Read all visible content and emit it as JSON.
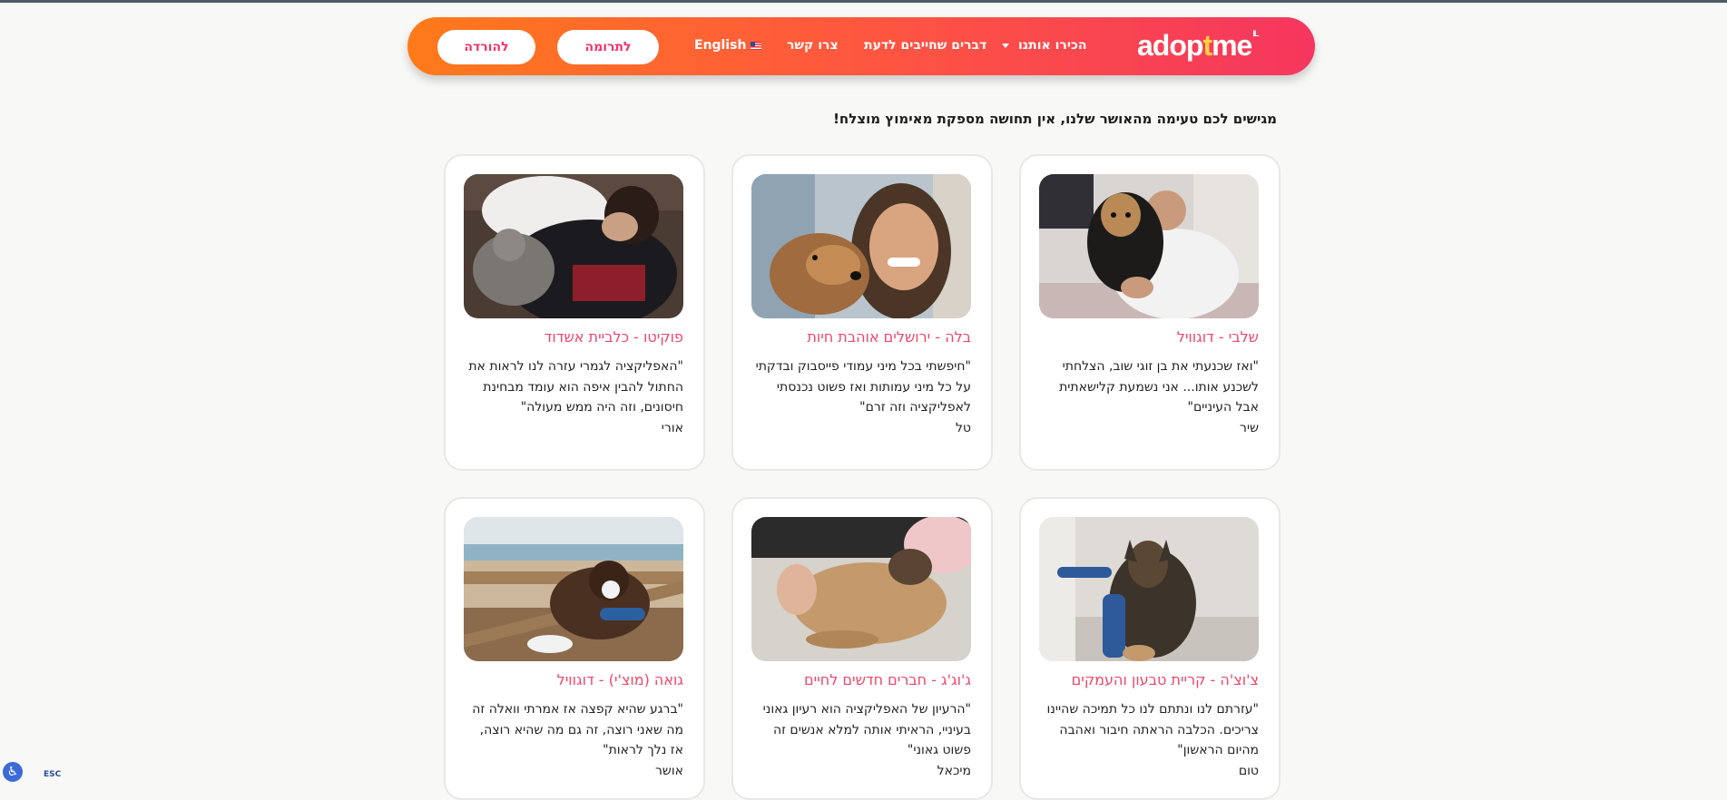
{
  "nav": {
    "download": "להורדה",
    "donate": "לתרומה",
    "english": "English",
    "contact": "צרו קשר",
    "must_know": "דברים שחייבים לדעת",
    "about": "הכירו אותנו",
    "logo_main": "adop",
    "logo_star": "t",
    "logo_end": "me",
    "logo_mark": "IL"
  },
  "headline": "מגישים לכם טעימה מהאושר שלנו, אין תחושה מספקת מאימוץ מוצלח!",
  "cards": [
    {
      "title": "שלבי - דוגוויל",
      "quote": "\"ואז שכנעתי את בן זוגי שוב, הצלחתי לשכנע אותו... אני נשמעת קלישאתית אבל העיניים\"",
      "author": "שיר"
    },
    {
      "title": "בלה - ירושלים אוהבת חיות",
      "quote": "\"חיפשתי בכל מיני עמודי פייסבוק ובדקתי על כל מיני עמותות ואז פשוט נכנסתי לאפליקציה וזה זרם\"",
      "author": "טל"
    },
    {
      "title": "פוקיטו - כלביית אשדוד",
      "quote": "\"האפליקציה לגמרי עזרה לנו לראות את החתול להבין איפה הוא עומד מבחינת חיסונים, וזה היה ממש מעולה\"",
      "author": "אורי"
    },
    {
      "title": "צ'וצ'ה - קריית טבעון והעמקים",
      "quote": "\"עזרתם לנו ונתתם לנו כל תמיכה שהיינו צריכים. הכלבה הראתה חיבור ואהבה מהיום הראשון\"",
      "author": "טום"
    },
    {
      "title": "ג'וג'ג - חברים חדשים לחיים",
      "quote": "\"הרעיון של האפליקציה הוא רעיון גאוני בעיניי, הראיתי אותה למלא אנשים זה פשוט גאוני\"",
      "author": "מיכאל"
    },
    {
      "title": "גואה (מוצ'י) - דוגוויל",
      "quote": "\"ברגע שהיא קפצה אז אמרתי וואלה זה מה שאני רוצה, זה גם מה שהיא רוצה, אז נלך לראות\"",
      "author": "אושר"
    }
  ],
  "accessibility": {
    "icon": "accessibility-icon",
    "esc": "ESC"
  },
  "colors": {
    "accent_orange": "#ff7a1a",
    "accent_pink": "#f5365f",
    "title_pink": "#f0466b"
  }
}
